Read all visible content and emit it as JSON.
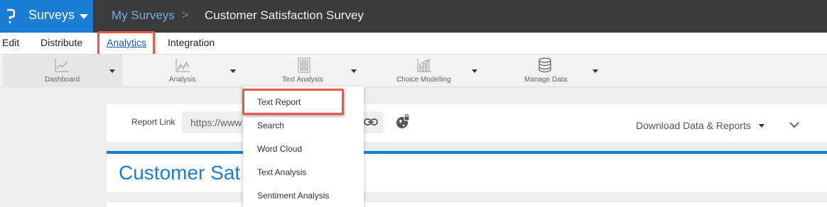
{
  "header": {
    "app_name": "Surveys",
    "breadcrumb_root": "My Surveys",
    "breadcrumb_separator": ">",
    "breadcrumb_current": "Customer Satisfaction Survey",
    "brand_color": "#1a7fd4"
  },
  "tabs": [
    {
      "label": "Edit",
      "active": false
    },
    {
      "label": "Distribute",
      "active": false
    },
    {
      "label": "Analytics",
      "active": true
    },
    {
      "label": "Integration",
      "active": false
    }
  ],
  "toolbar": [
    {
      "label": "Dashboard",
      "icon": "line-chart-icon"
    },
    {
      "label": "Analysis",
      "icon": "area-chart-icon"
    },
    {
      "label": "Text Analysis",
      "icon": "grid-document-icon"
    },
    {
      "label": "Choice Modelling",
      "icon": "bar-line-chart-icon"
    },
    {
      "label": "Manage Data",
      "icon": "database-icon"
    }
  ],
  "text_analysis_menu": [
    {
      "label": "Text Report",
      "highlighted": true
    },
    {
      "label": "Search"
    },
    {
      "label": "Word Cloud"
    },
    {
      "label": "Text Analysis"
    },
    {
      "label": "Sentiment Analysis"
    }
  ],
  "report": {
    "link_label": "Report Link",
    "link_value": "https://www",
    "download_label": "Download Data & Reports"
  },
  "survey_title": "Customer Sat                    rvey",
  "highlight_color": "#e55a4a"
}
